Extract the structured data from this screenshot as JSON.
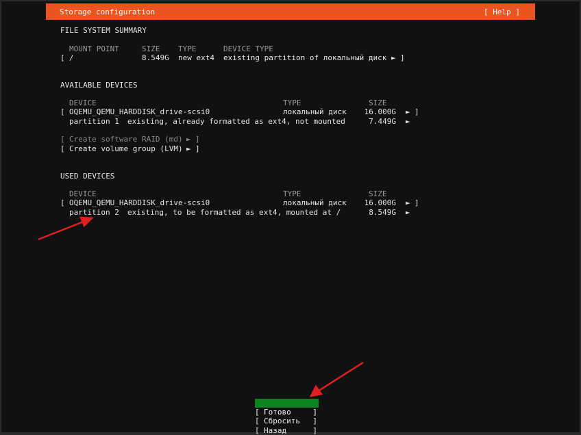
{
  "header": {
    "title": "Storage configuration",
    "help": "[ Help ]"
  },
  "fs_summary": {
    "title": "FILE SYSTEM SUMMARY",
    "columns": [
      "MOUNT POINT",
      "SIZE",
      "TYPE",
      "DEVICE TYPE"
    ],
    "rows": [
      {
        "mount": "/",
        "size": "8.549G",
        "type": "new ext4",
        "device_type": "existing partition of локальный диск"
      }
    ]
  },
  "available": {
    "title": "AVAILABLE DEVICES",
    "columns": [
      "DEVICE",
      "TYPE",
      "SIZE"
    ],
    "device": {
      "name": "OQEMU_QEMU_HARDDISK_drive-scsi0",
      "type": "локальный диск",
      "size": "16.000G"
    },
    "partition": {
      "name": "partition 1",
      "desc": "existing, already formatted as ext4, not mounted",
      "size": "7.449G"
    },
    "raid": "Create software RAID (md)",
    "lvm": "Create volume group (LVM)"
  },
  "used": {
    "title": "USED DEVICES",
    "columns": [
      "DEVICE",
      "TYPE",
      "SIZE"
    ],
    "device": {
      "name": "OQEMU_QEMU_HARDDISK_drive-scsi0",
      "type": "локальный диск",
      "size": "16.000G"
    },
    "partition": {
      "name": "partition 2",
      "desc": "existing, to be formatted as ext4, mounted at /",
      "size": "8.549G"
    }
  },
  "buttons": {
    "done": "Готово",
    "reset": "Сбросить",
    "back": "Назад"
  },
  "glyphs": {
    "lb": "[",
    "rb": "]",
    "arrow": "►"
  },
  "colors": {
    "accent": "#e95420",
    "selected": "#0e8420",
    "annotation": "#e02020"
  }
}
